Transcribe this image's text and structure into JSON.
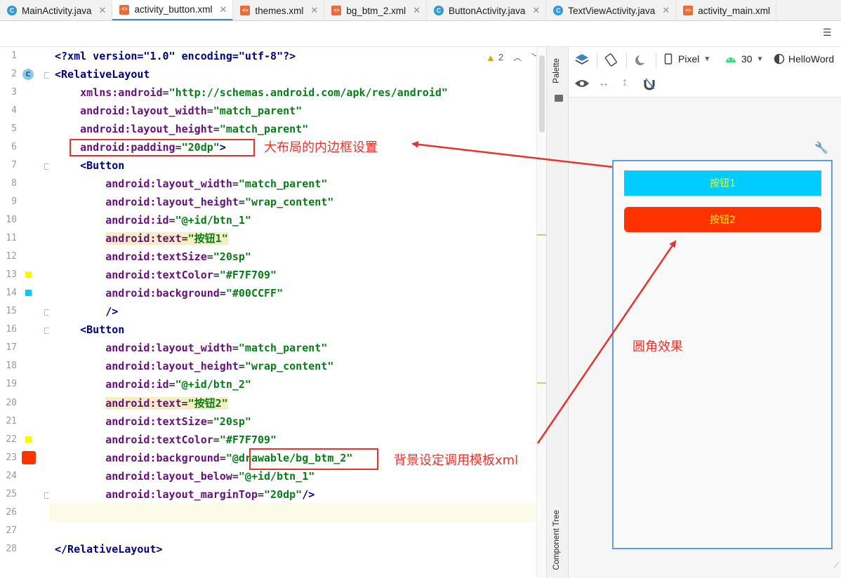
{
  "tabs": [
    {
      "label": "MainActivity.java",
      "kind": "java",
      "active": false
    },
    {
      "label": "activity_button.xml",
      "kind": "xml",
      "active": true
    },
    {
      "label": "themes.xml",
      "kind": "xml",
      "active": false
    },
    {
      "label": "bg_btm_2.xml",
      "kind": "xml",
      "active": false
    },
    {
      "label": "ButtonActivity.java",
      "kind": "java",
      "active": false
    },
    {
      "label": "TextViewActivity.java",
      "kind": "java",
      "active": false
    },
    {
      "label": "activity_main.xml",
      "kind": "xml",
      "active": false
    }
  ],
  "editor": {
    "warning_count": "2",
    "line_numbers": [
      "1",
      "2",
      "3",
      "4",
      "5",
      "6",
      "7",
      "8",
      "9",
      "10",
      "11",
      "12",
      "13",
      "14",
      "15",
      "16",
      "17",
      "18",
      "19",
      "20",
      "21",
      "22",
      "23",
      "24",
      "25",
      "26",
      "27",
      "28"
    ],
    "lines": {
      "l1": "<?xml version=\"1.0\" encoding=\"utf-8\"?>",
      "l2": "<RelativeLayout",
      "l3_attr": "xmlns:android",
      "l3_val": "\"http://schemas.android.com/apk/res/android\"",
      "l4_attr": "android:layout_width",
      "l4_val": "\"match_parent\"",
      "l5_attr": "android:layout_height",
      "l5_val": "\"match_parent\"",
      "l6_attr": "android:padding",
      "l6_val": "\"20dp\"",
      "l7": "<Button",
      "l8_attr": "android:layout_width",
      "l8_val": "\"match_parent\"",
      "l9_attr": "android:layout_height",
      "l9_val": "\"wrap_content\"",
      "l10_attr": "android:id",
      "l10_val": "\"@+id/btn_1\"",
      "l11_attr": "android:text",
      "l11_val": "\"按钮1\"",
      "l12_attr": "android:textSize",
      "l12_val": "\"20sp\"",
      "l13_attr": "android:textColor",
      "l13_val": "\"#F7F709\"",
      "l14_attr": "android:background",
      "l14_val": "\"#00CCFF\"",
      "l15": "/>",
      "l16": "<Button",
      "l17_attr": "android:layout_width",
      "l17_val": "\"match_parent\"",
      "l18_attr": "android:layout_height",
      "l18_val": "\"wrap_content\"",
      "l19_attr": "android:id",
      "l19_val": "\"@+id/btn_2\"",
      "l20_attr": "android:text",
      "l20_val": "\"按钮2\"",
      "l21_attr": "android:textSize",
      "l21_val": "\"20sp\"",
      "l22_attr": "android:textColor",
      "l22_val": "\"#F7F709\"",
      "l23_attr": "android:background",
      "l23_val": "\"@drawable/bg_btm_2\"",
      "l24_attr": "android:layout_below",
      "l24_val": "\"@+id/btn_1\"",
      "l25_attr": "android:layout_marginTop",
      "l25_val": "\"20dp\"",
      "l28": "</RelativeLayout>"
    }
  },
  "side_panel": {
    "palette_label": "Palette",
    "component_tree_label": "Component Tree"
  },
  "design_toolbar": {
    "device": "Pixel",
    "api_level": "30",
    "theme": "HelloWord"
  },
  "preview": {
    "button1_text": "按钮1",
    "button2_text": "按钮2",
    "button1_color": "#00CCFF",
    "button2_color": "#FF3300",
    "text_color": "#F7F709"
  },
  "annotations": {
    "padding_note": "大布局的内边框设置",
    "rounded_note": "圆角效果",
    "background_note": "背景设定调用模板xml"
  },
  "colors": {
    "annotation_red": "#E8322B",
    "gutter_yellow": "#F7F709",
    "gutter_cyan": "#00CCFF",
    "gutter_red": "#FF3300"
  }
}
